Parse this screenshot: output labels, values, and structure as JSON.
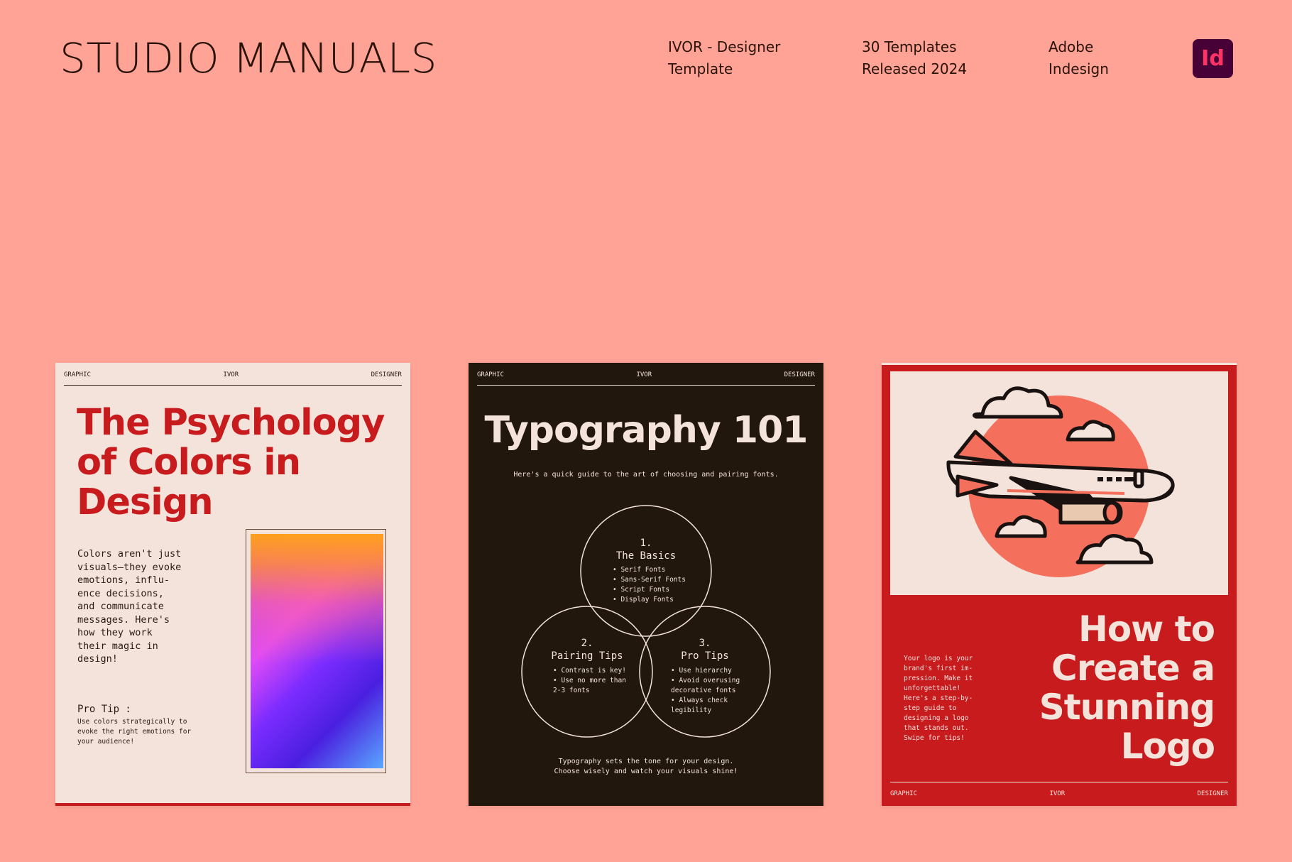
{
  "header": {
    "brand": "STUDIO MANUALS",
    "product": "IVOR - Designer\nTemplate",
    "templates": "30 Templates\nReleased 2024",
    "software": "Adobe\nIndesign",
    "badge": "Id"
  },
  "topbar": {
    "left": "GRAPHIC",
    "center": "IVOR",
    "right": "DESIGNER"
  },
  "card1": {
    "title": "The Psychology of Colors in Design",
    "body": "Colors aren't just\nvisuals—they evoke\nemotions, influ-\nence decisions,\nand communicate\nmessages. Here's\nhow they work\ntheir magic in\ndesign!",
    "protip_label": "Pro Tip :",
    "protip_text": "Use colors strategically to evoke the right emotions for your audience!"
  },
  "card2": {
    "title": "Typography 101",
    "subtitle": "Here's a quick guide to the art of choosing and pairing fonts.",
    "circle1": {
      "num": "1.",
      "label": "The Basics",
      "items": [
        "Serif Fonts",
        "Sans-Serif Fonts",
        "Script Fonts",
        "Display Fonts"
      ]
    },
    "circle2": {
      "num": "2.",
      "label": "Pairing Tips",
      "items": [
        "Contrast is key!",
        "Use no more than 2-3 fonts"
      ]
    },
    "circle3": {
      "num": "3.",
      "label": "Pro Tips",
      "items": [
        "Use hierarchy",
        "Avoid overusing decorative fonts",
        "Always check legibility"
      ]
    },
    "footer": "Typography sets the tone for your design.\nChoose wisely and watch your visuals shine!"
  },
  "card3": {
    "title": "How to Create a Stunning Logo",
    "desc": "Your logo is your brand's first im-pression. Make it unforgettable! Here's a step-by-step guide to designing a logo that stands out. Swipe for tips!"
  },
  "colors": {
    "background": "#FFA396",
    "red": "#C81B1E",
    "cream": "#F3E3DB",
    "dark": "#22170D",
    "indesign": "#470137"
  }
}
